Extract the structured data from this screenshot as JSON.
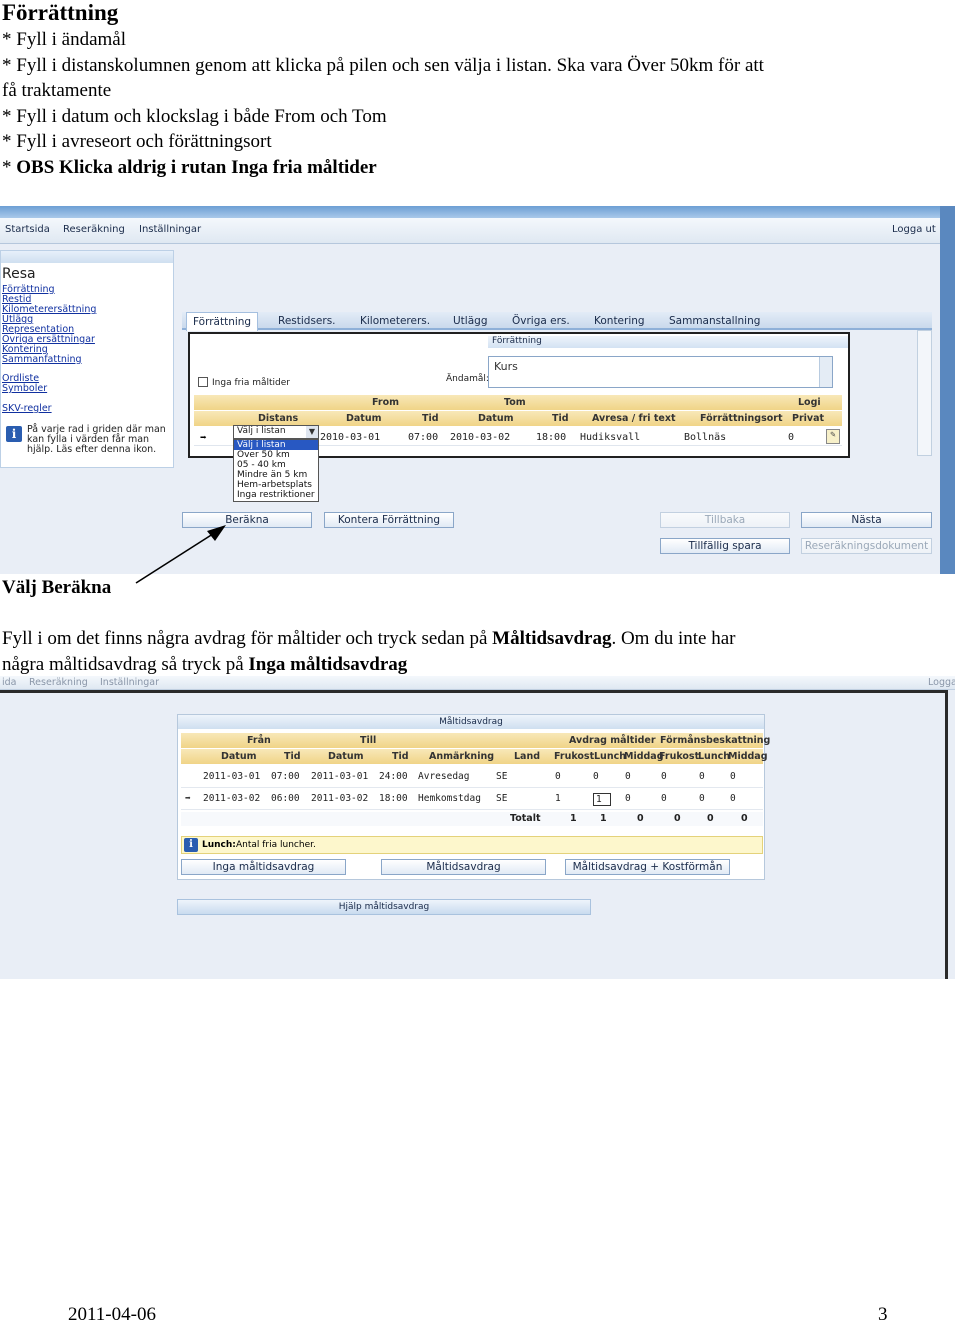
{
  "title": "Förrättning",
  "instructions": [
    "* Fyll i ändamål",
    "* Fyll i distanskolumnen genom att klicka på pilen och sen välja i listan.  Ska vara Över 50km för att",
    "få traktamente",
    "* Fyll i datum och klockslag i både From och Tom",
    "* Fyll i avreseort och förättningsort"
  ],
  "obs_prefix": "* ",
  "obs": "OBS Klicka aldrig i rutan Inga fria måltider",
  "screen1": {
    "nav": {
      "startsida": "Startsida",
      "reserakning": "Reseräkning",
      "installningar": "Inställningar",
      "logout": "Logga ut"
    },
    "sidebar": {
      "title": "Resa",
      "links": [
        "Förrättning",
        "Restid",
        "Kilometerersättning",
        "Utlägg",
        "Representation",
        "Övriga ersättningar",
        "Kontering",
        "Sammanfattning",
        "Ordliste",
        "Symboler",
        "SKV-regler"
      ],
      "info": "På varje rad i griden där man kan fylla i värden får man hjälp. Läs efter denna ikon."
    },
    "tabs": [
      "Förrättning",
      "Restidsers.",
      "Kilometerers.",
      "Utlägg",
      "Övriga ers.",
      "Kontering",
      "Sammanstallning"
    ],
    "panel_title": "Förrättning",
    "inga_fria": "Inga fria måltider",
    "andamal_label": "Ändamål:",
    "andamal_value": "Kurs",
    "headers1": {
      "from": "From",
      "tom": "Tom",
      "logi": "Logi"
    },
    "headers2": {
      "distans": "Distans",
      "datum1": "Datum",
      "tid1": "Tid",
      "datum2": "Datum",
      "tid2": "Tid",
      "avresa": "Avresa / fri text",
      "forrattningsort": "Förrättningsort",
      "privat": "Privat"
    },
    "row": {
      "from_date": "2010-03-01",
      "from_time": "07:00",
      "to_date": "2010-03-02",
      "to_time": "18:00",
      "avresa": "Hudiksvall",
      "ort": "Bollnäs",
      "logi": "0"
    },
    "dropdown_value": "Välj i listan",
    "dropdown_options": [
      "Välj i listan",
      "Över 50 km",
      "05 - 40 km",
      "Mindre än 5 km",
      "Hem-arbetsplats",
      "Inga restriktioner"
    ],
    "buttons": {
      "berakna": "Beräkna",
      "kontera": "Kontera Förrättning",
      "tillbaka": "Tillbaka",
      "nasta": "Nästa",
      "spara": "Tillfällig spara",
      "dokument": "Reseräkningsdokument"
    }
  },
  "valj_berakna": "Välj Beräkna",
  "para2_line1_a": "Fyll i om det finns några avdrag för måltider  och tryck sedan på ",
  "para2_line1_b": "Måltidsavdrag",
  "para2_line1_c": ". Om du inte har",
  "para2_line2_a": "några måltidsavdrag så tryck på ",
  "para2_line2_b": "Inga måltidsavdrag",
  "screen2": {
    "nav": {
      "ida": "ida",
      "reserakning": "Reseräkning",
      "installningar": "Inställningar",
      "logout": "Logga"
    },
    "panel_title": "Måltidsavdrag",
    "headers1": {
      "fran": "Från",
      "till": "Till",
      "avdrag": "Avdrag måltider",
      "formans": "Förmånsbeskattning"
    },
    "headers2": {
      "datum1": "Datum",
      "tid1": "Tid",
      "datum2": "Datum",
      "tid2": "Tid",
      "anmarkning": "Anmärkning",
      "land": "Land",
      "frukost1": "Frukost",
      "lunch1": "Lunch",
      "middag1": "Middag",
      "frukost2": "Frukost",
      "lunch2": "Lunch",
      "middag2": "Middag"
    },
    "rows": [
      {
        "d1": "2011-03-01",
        "t1": "07:00",
        "d2": "2011-03-01",
        "t2": "24:00",
        "anm": "Avresedag",
        "land": "SE",
        "v": [
          "0",
          "0",
          "0",
          "0",
          "0",
          "0"
        ]
      },
      {
        "d1": "2011-03-02",
        "t1": "06:00",
        "d2": "2011-03-02",
        "t2": "18:00",
        "anm": "Hemkomstdag",
        "land": "SE",
        "v": [
          "1",
          "1",
          "0",
          "0",
          "0",
          "0"
        ]
      }
    ],
    "total_label": "Totalt",
    "totals": [
      "1",
      "1",
      "0",
      "0",
      "0",
      "0"
    ],
    "lunch_label": "Lunch:",
    "lunch_text": "Antal fria luncher.",
    "buttons": {
      "inga": "Inga måltidsavdrag",
      "maltid": "Måltidsavdrag",
      "kostforman": "Måltidsavdrag + Kostförmån"
    },
    "help": "Hjälp måltidsavdrag"
  },
  "footer": {
    "date": "2011-04-06",
    "page": "3"
  }
}
